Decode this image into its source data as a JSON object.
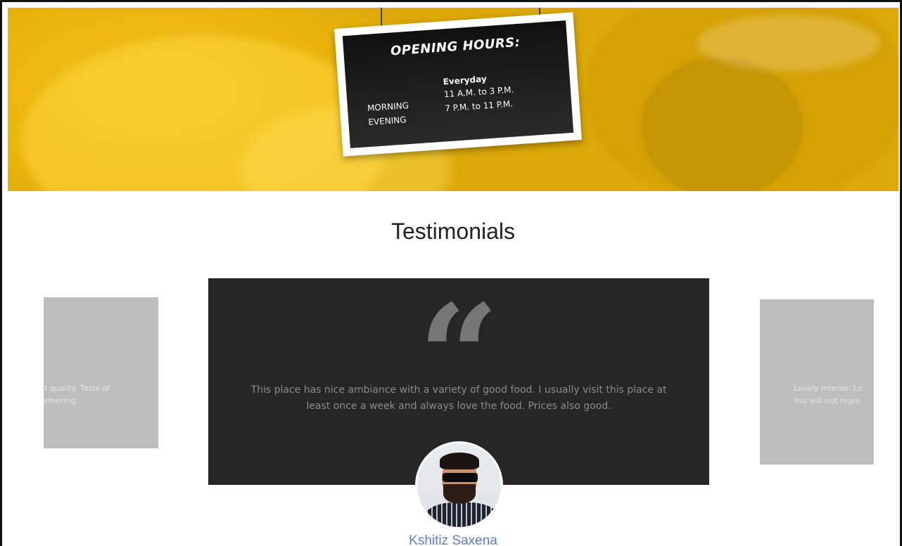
{
  "hours_sign": {
    "title": "OPENING HOURS:",
    "subtitle": "Everyday",
    "rows": [
      {
        "label": "MORNING",
        "time": "11 A.M. to 3 P.M."
      },
      {
        "label": "EVENING",
        "time": "7 P.M. to 11 P.M."
      }
    ]
  },
  "testimonials": {
    "heading": "Testimonials",
    "quote_glyph": "“",
    "active": {
      "text": "This place has nice ambiance with a variety of good food. I usually visit this place at least once a week and always love the food. Prices also good.",
      "author": "Kshitiz Saxena"
    },
    "previous_card": {
      "line1": "d quality. Taste of",
      "line2": "gathering."
    },
    "next_card": {
      "line1": "Lovely interior. Lo",
      "line2": "You will not regre"
    }
  },
  "colors": {
    "hero_yellow": "#e7b20b",
    "card_dark": "#262626",
    "side_card": "#bdbdbd",
    "author_name": "#5b7fd0"
  }
}
